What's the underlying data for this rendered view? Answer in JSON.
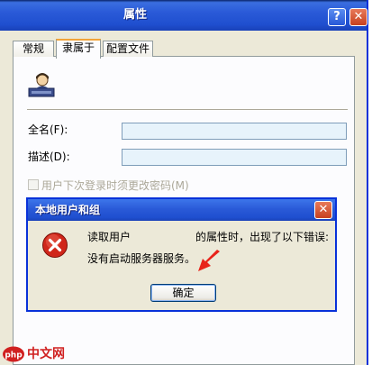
{
  "window": {
    "title": "属性",
    "help_label": "?",
    "close_label": "✕"
  },
  "tabs": [
    {
      "label": "常规"
    },
    {
      "label": "隶属于"
    },
    {
      "label": "配置文件"
    }
  ],
  "form": {
    "full_name_label": "全名(F):",
    "full_name_value": "",
    "description_label": "描述(D):",
    "description_value": "",
    "must_change_password_label": "用户下次登录时须更改密码(M)"
  },
  "dialog": {
    "title": "本地用户和组",
    "close_label": "✕",
    "message_part1": "读取用户",
    "message_part2": "的属性时，出现了以下错误:",
    "message_line2": "没有启动服务器服务。",
    "ok_label": "确定"
  },
  "watermark": {
    "text": "中文网",
    "logo_text": "php"
  },
  "colors": {
    "titlebar": "#2a5ad8",
    "window_bg": "#ece9d8",
    "input_bg": "#e7f3fb",
    "arrow": "#e8231a",
    "error_icon": "#d0261a"
  }
}
